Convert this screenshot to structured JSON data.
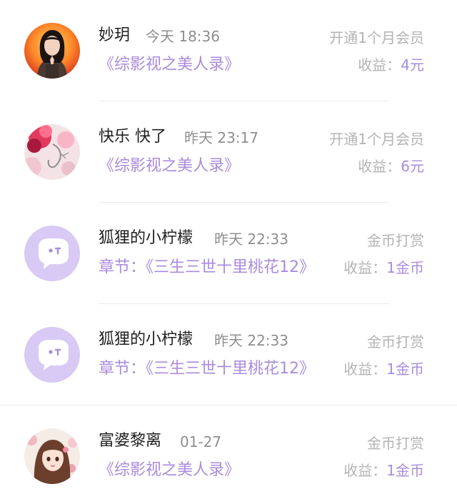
{
  "records": [
    {
      "avatar_icon": "woman-photo-avatar",
      "name": "妙玥",
      "time": "今天 18:36",
      "type": "开通1个月会员",
      "book": "《综影视之美人录》",
      "earn_label": "收益：",
      "earn_value": "4元"
    },
    {
      "avatar_icon": "flower-photo-avatar",
      "name": "快乐 快了",
      "time": "昨天 23:17",
      "type": "开通1个月会员",
      "book": "《综影视之美人录》",
      "earn_label": "收益：",
      "earn_value": "6元"
    },
    {
      "avatar_icon": "default-chat-avatar",
      "name": "狐狸的小柠檬",
      "time": "昨天 22:33",
      "type": "金币打赏",
      "book": "章节：《三生三世十里桃花12》",
      "earn_label": "收益：",
      "earn_value": "1金币"
    },
    {
      "avatar_icon": "default-chat-avatar",
      "name": "狐狸的小柠檬",
      "time": "昨天 22:33",
      "type": "金币打赏",
      "book": "章节：《三生三世十里桃花12》",
      "earn_label": "收益：",
      "earn_value": "1金币"
    },
    {
      "avatar_icon": "anime-girl-avatar",
      "name": "富婆黎离",
      "time": "01-27",
      "type": "金币打赏",
      "book": "《综影视之美人录》",
      "earn_label": "收益：",
      "earn_value": "1金币"
    }
  ],
  "colors": {
    "accent": "#a98bdc",
    "avatar_default_bg": "#d9c9f5",
    "name_text": "#1f1f1f",
    "muted_text": "#b3b3b3"
  }
}
